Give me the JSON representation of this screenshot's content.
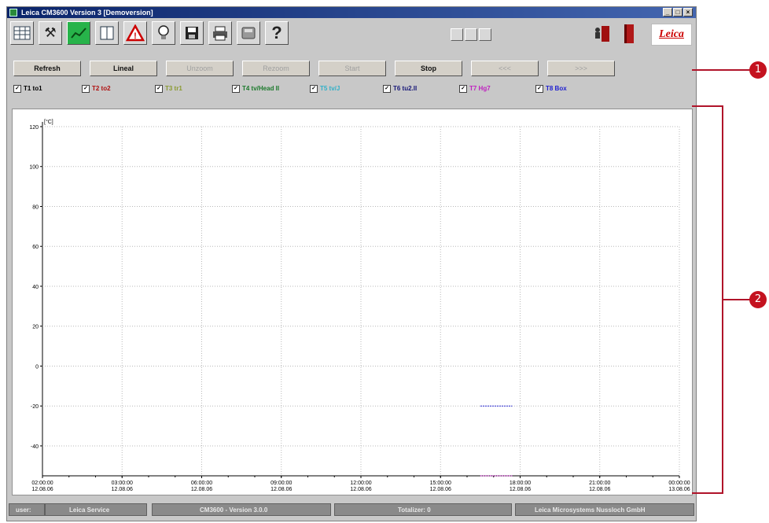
{
  "window": {
    "title": "Leica CM3600 Version 3  [Demoversion]",
    "controls": [
      "_",
      "□",
      "×"
    ]
  },
  "toolbar": {
    "icons": [
      "table-icon",
      "tools-icon",
      "chart-icon",
      "book-icon",
      "warning-icon",
      "bulb-icon",
      "save-icon",
      "printer-icon",
      "disk-icon",
      "help-icon"
    ],
    "help_label": "?",
    "logo": "Leica"
  },
  "buttons": [
    {
      "label": "Refresh",
      "enabled": true
    },
    {
      "label": "Lineal",
      "enabled": true
    },
    {
      "label": "Unzoom",
      "enabled": false
    },
    {
      "label": "Rezoom",
      "enabled": false
    },
    {
      "label": "Start",
      "enabled": false
    },
    {
      "label": "Stop",
      "enabled": true
    },
    {
      "label": "<<<",
      "enabled": false
    },
    {
      "label": ">>>",
      "enabled": false
    }
  ],
  "channels": [
    {
      "label": "T1 to1",
      "color": "#000000",
      "checked": true
    },
    {
      "label": "T2 to2",
      "color": "#b01010",
      "checked": true
    },
    {
      "label": "T3 tr1",
      "color": "#8a9a30",
      "checked": true
    },
    {
      "label": "T4 tv/Head II",
      "color": "#1c7a2c",
      "checked": true
    },
    {
      "label": "T5 tv/J",
      "color": "#30b0c8",
      "checked": true
    },
    {
      "label": "T6 tu2.II",
      "color": "#181878",
      "checked": true
    },
    {
      "label": "T7 Hg7",
      "color": "#c020c0",
      "checked": true
    },
    {
      "label": "T8 Box",
      "color": "#2020d0",
      "checked": true
    }
  ],
  "chart_data": {
    "type": "line",
    "ylabel": "[°C]",
    "ylim": [
      -55,
      120
    ],
    "yticks": [
      120,
      100,
      80,
      60,
      40,
      20,
      0,
      -20,
      -40
    ],
    "x_ticks": [
      {
        "time": "02:00:00",
        "date": "12.08.06"
      },
      {
        "time": "03:00:00",
        "date": "12.08.06"
      },
      {
        "time": "06:00:00",
        "date": "12.08.06"
      },
      {
        "time": "09:00:00",
        "date": "12.08.06"
      },
      {
        "time": "12:00:00",
        "date": "12.08.06"
      },
      {
        "time": "15:00:00",
        "date": "12.08.06"
      },
      {
        "time": "18:00:00",
        "date": "12.08.06"
      },
      {
        "time": "21:00:00",
        "date": "12.08.06"
      },
      {
        "time": "00:00:00",
        "date": "13.08.06"
      }
    ],
    "grid": true,
    "series": [
      {
        "name": "T8 Box",
        "color": "#2020d0",
        "x": [
          5.5,
          5.9
        ],
        "y": [
          -20,
          -20
        ]
      },
      {
        "name": "T7 Hg7",
        "color": "#c020c0",
        "x": [
          5.5,
          5.9
        ],
        "y": [
          -55,
          -55
        ]
      }
    ]
  },
  "status": [
    {
      "label": "user:"
    },
    {
      "label": "Leica Service"
    },
    {
      "label": "CM3600 - Version 3.0.0"
    },
    {
      "label": "Totalizer:  0"
    },
    {
      "label": "Leica Microsystems Nussloch GmbH"
    }
  ],
  "callouts": [
    "1",
    "2"
  ]
}
